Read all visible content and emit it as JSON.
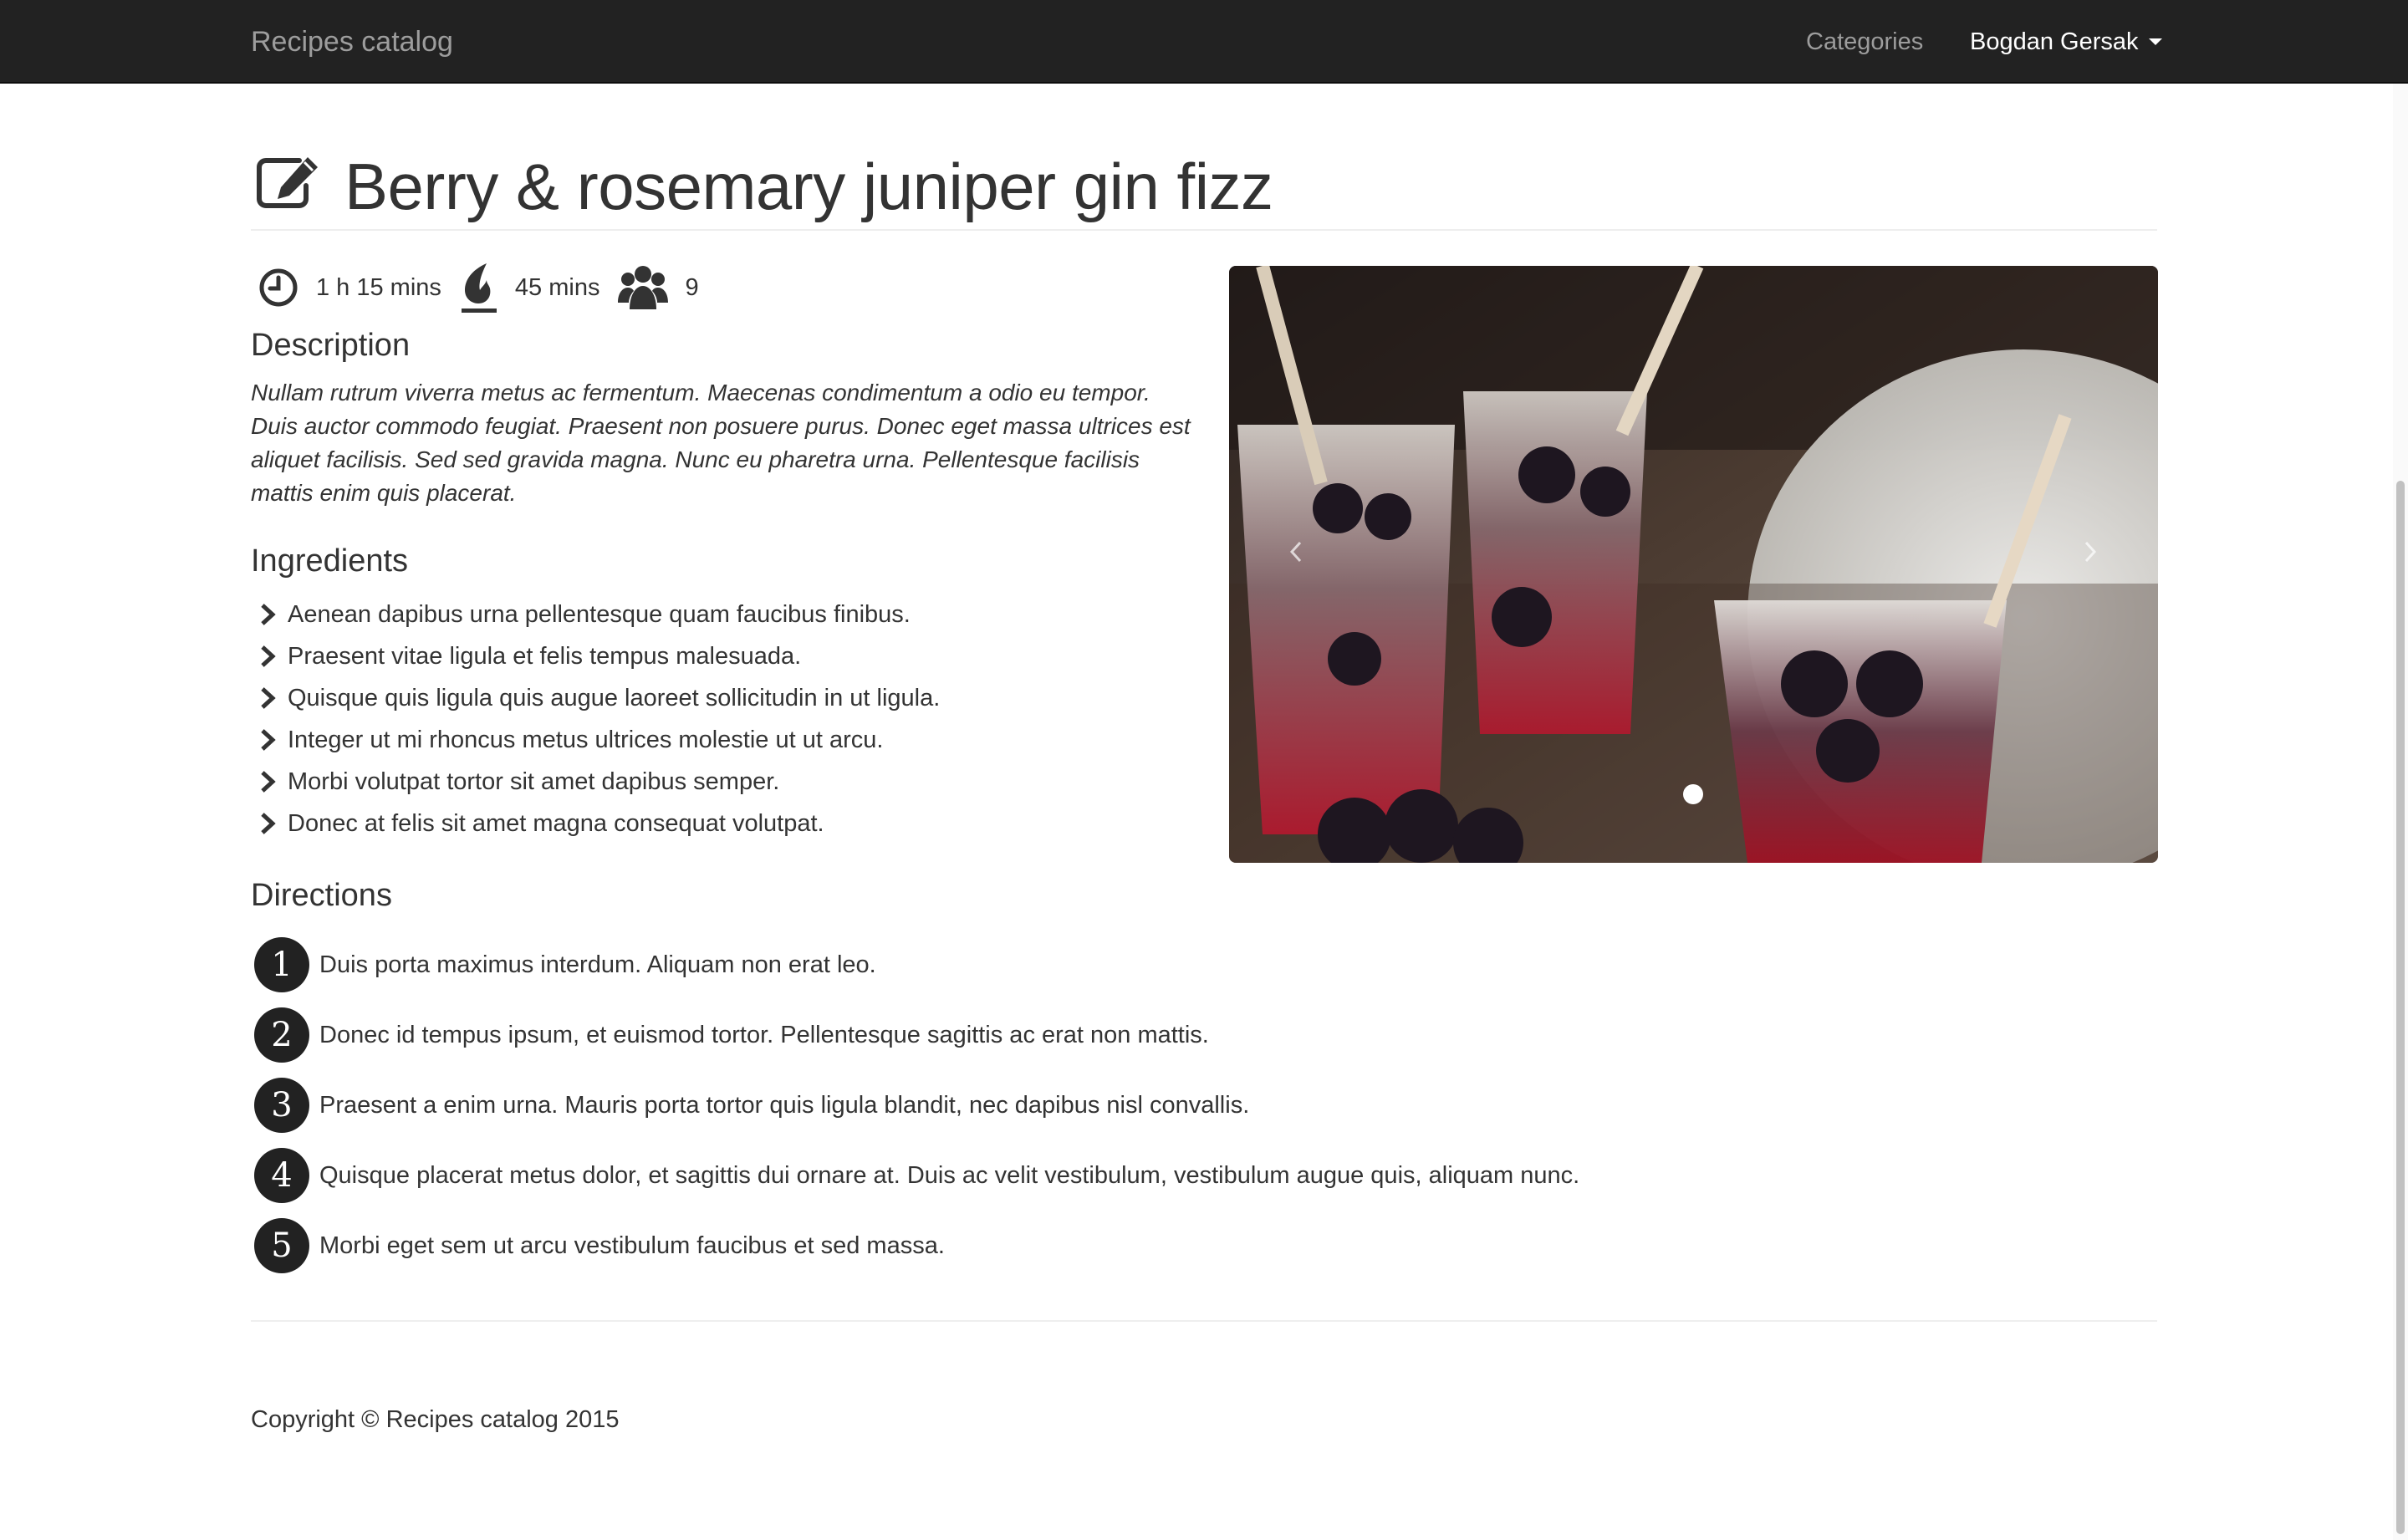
{
  "navbar": {
    "brand": "Recipes catalog",
    "categories_label": "Categories",
    "user_label": "Bogdan Gersak"
  },
  "recipe": {
    "title": "Berry & rosemary juniper gin fizz",
    "total_time": "1 h 15 mins",
    "cook_time": "45 mins",
    "servings": "9",
    "description_heading": "Description",
    "description": "Nullam rutrum viverra metus ac fermentum. Maecenas condimentum a odio eu tempor. Duis auctor commodo feugiat. Praesent non posuere purus. Donec eget massa ultrices est aliquet facilisis. Sed sed gravida magna. Nunc eu pharetra urna. Pellentesque facilisis mattis enim quis placerat.",
    "ingredients_heading": "Ingredients",
    "ingredients": [
      "Aenean dapibus urna pellentesque quam faucibus finibus.",
      "Praesent vitae ligula et felis tempus malesuada.",
      "Quisque quis ligula quis augue laoreet sollicitudin in ut ligula.",
      "Integer ut mi rhoncus metus ultrices molestie ut ut arcu.",
      "Morbi volutpat tortor sit amet dapibus semper.",
      "Donec at felis sit amet magna consequat volutpat."
    ],
    "directions_heading": "Directions",
    "directions": [
      {
        "num": "1",
        "text": "Duis porta maximus interdum. Aliquam non erat leo."
      },
      {
        "num": "2",
        "text": "Donec id tempus ipsum, et euismod tortor. Pellentesque sagittis ac erat non mattis."
      },
      {
        "num": "3",
        "text": "Praesent a enim urna. Mauris porta tortor quis ligula blandit, nec dapibus nisl convallis."
      },
      {
        "num": "4",
        "text": "Quisque placerat metus dolor, et sagittis dui ornare at. Duis ac velit vestibulum, vestibulum augue quis, aliquam nunc."
      },
      {
        "num": "5",
        "text": "Morbi eget sem ut arcu vestibulum faucibus et sed massa."
      }
    ]
  },
  "carousel": {
    "icons": [
      "chevron-left-icon",
      "chevron-right-icon"
    ]
  },
  "footer": {
    "copyright": "Copyright © Recipes catalog 2015"
  },
  "colors": {
    "navbar_bg": "#222222",
    "nav_muted": "#9d9d9d",
    "text": "#333333",
    "divider": "#eeeeee"
  },
  "icons": {
    "title": "edit-icon",
    "total_time": "clock-icon",
    "cook_time": "fire-icon",
    "servings": "users-icon",
    "ingredient_bullet": "chevron-right-icon"
  }
}
